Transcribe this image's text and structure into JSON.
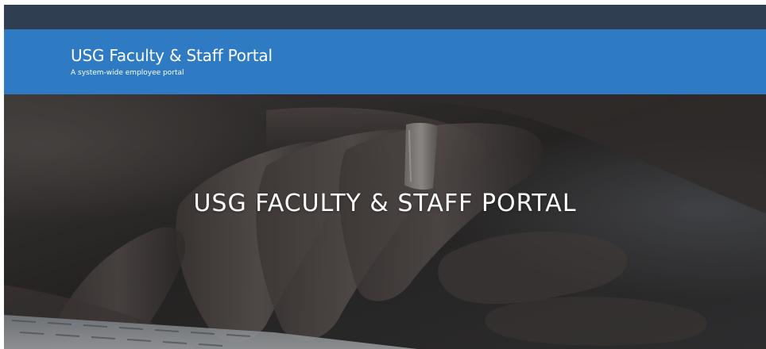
{
  "top_bar": {
    "color": "#2f3e50"
  },
  "header": {
    "title": "USG Faculty & Staff Portal",
    "tagline": "A system-wide employee portal",
    "background": "#2f7bc3"
  },
  "hero": {
    "heading": "USG FACULTY & STAFF PORTAL",
    "image_description_icon": "hands-on-keyboard-photo"
  }
}
